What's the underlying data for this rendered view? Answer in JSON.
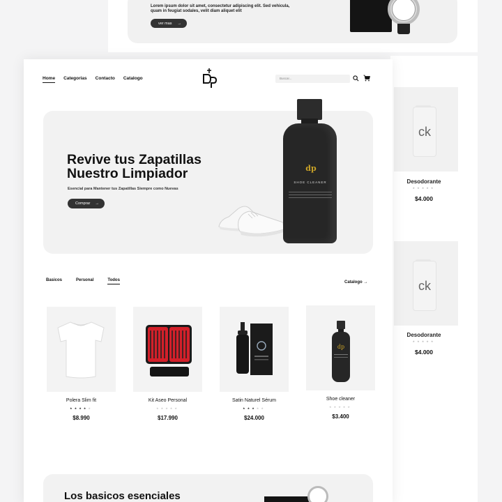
{
  "bg_top": {
    "text": "Lorem ipsum dolor sit amet, consectetur adipiscing elit. Sed vehicula, quam in feugiat sodales, velit diam aliquet elit",
    "button": "ver mas",
    "arrow": "→"
  },
  "side_products": [
    {
      "brand": "ck",
      "name": "Desodorante",
      "stars": "★★★★★",
      "price": "$4.000"
    },
    {
      "brand": "ck",
      "name": "Desodorante",
      "stars": "★★★★★",
      "price": "$4.000"
    }
  ],
  "nav": {
    "links": [
      "Home",
      "Categorias",
      "Contacto",
      "Catalogo"
    ],
    "search_placeholder": "Buscar..."
  },
  "logo": {
    "text": "DP"
  },
  "hero": {
    "title": "Revive tus Zapatillas Nuestro Limpiador",
    "subtitle": "Esencial para Mantener tus Zapatillas Siempre como Nuevas",
    "button": "Comprar",
    "arrow": "→",
    "bottle_brand": "dp",
    "bottle_name": "SHOE CLEANER"
  },
  "tabs": {
    "items": [
      "Basicos",
      "Personal",
      "Todos"
    ],
    "catalog": "Catalogo →"
  },
  "products": [
    {
      "name": "Polera Slim fit",
      "stars": "★★★★★",
      "rating": 4,
      "price": "$8.990"
    },
    {
      "name": "Kit  Aseo Personal",
      "stars": "★★★★★",
      "rating": 0,
      "price": "$17.990"
    },
    {
      "name": "Satin Naturel Sérum",
      "stars": "★★★★★",
      "rating": 3,
      "price": "$24.000"
    },
    {
      "name": "Shoe cleaner",
      "stars": "★★★★★",
      "rating": 0,
      "price": "$3.400"
    }
  ],
  "basics": {
    "title": "Los basicos esenciales"
  },
  "colors": {
    "dark": "#333333",
    "card": "#f2f2f2",
    "gold": "#c9a227"
  }
}
